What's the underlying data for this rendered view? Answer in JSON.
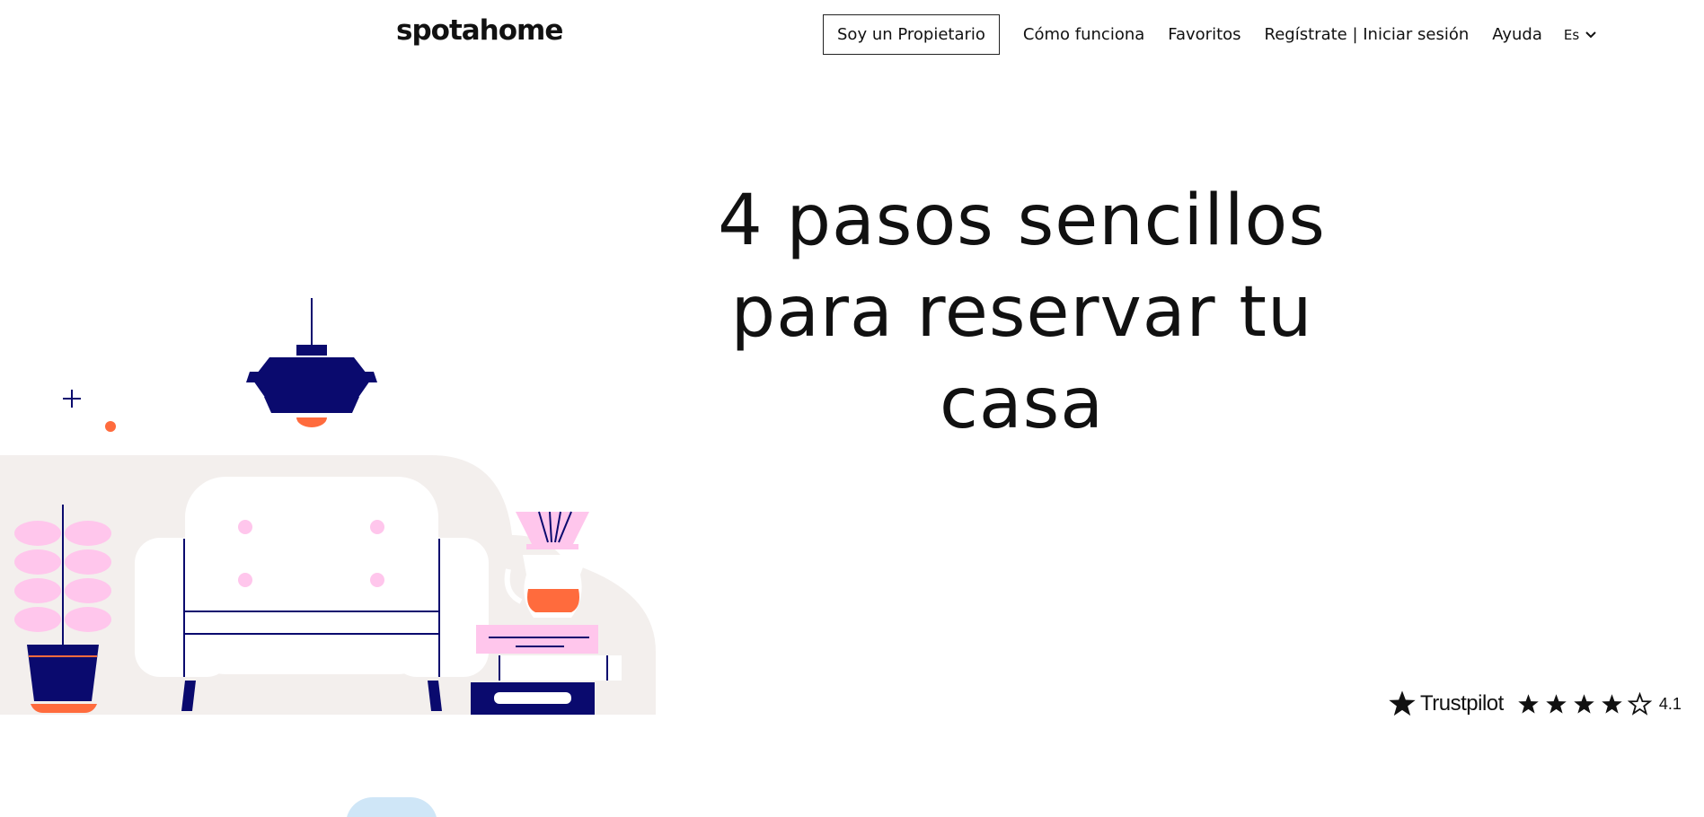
{
  "header": {
    "logo": "spotahome",
    "owner_button": "Soy un Propietario",
    "nav": [
      {
        "label": "Cómo funciona"
      },
      {
        "label": "Favoritos"
      },
      {
        "label": "Regístrate | Iniciar sesión"
      },
      {
        "label": "Ayuda"
      }
    ],
    "language": "Es",
    "language_icon": "chevron-down-icon"
  },
  "hero": {
    "title_lines": [
      "4 pasos sencillos",
      "para reservar tu",
      "casa"
    ]
  },
  "trustpilot": {
    "brand": "Trustpilot",
    "rating": "4.1",
    "stars_filled": 4,
    "stars_total": 5
  },
  "colors": {
    "navy": "#0a0a6e",
    "orange": "#ff6b3d",
    "pink": "#ffc6ec",
    "beige": "#f3efed",
    "light_blue": "#cfe6f7"
  }
}
